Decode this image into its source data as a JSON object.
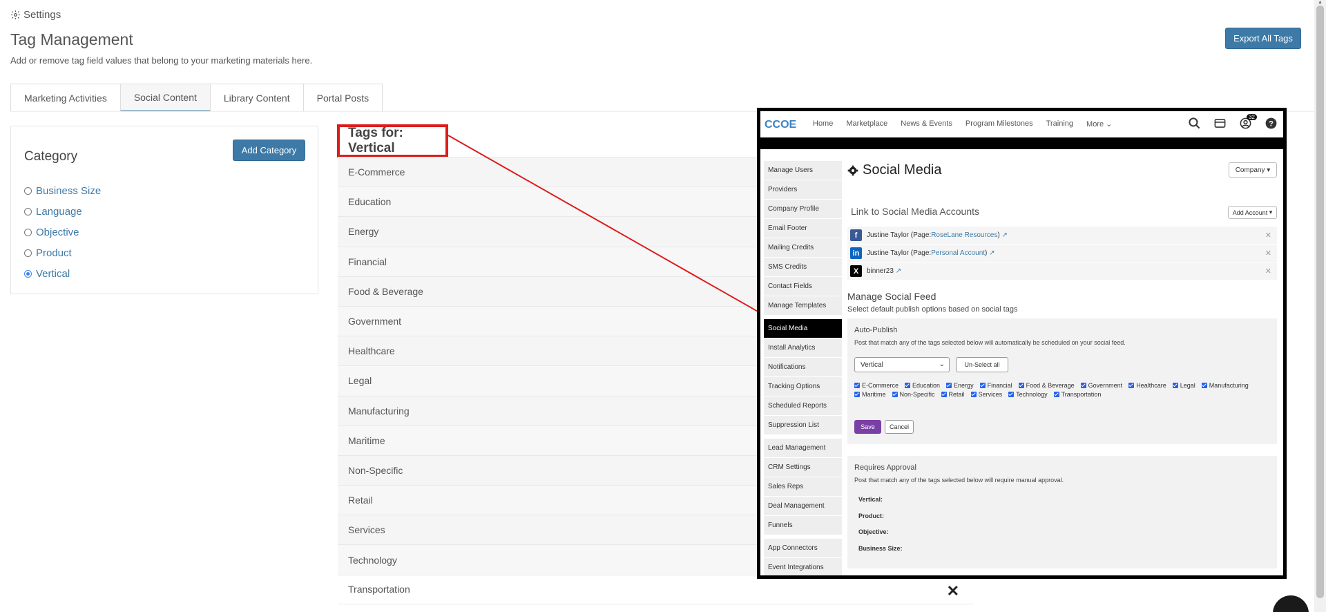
{
  "header": {
    "breadcrumb": "Settings",
    "title": "Tag Management",
    "subtitle": "Add or remove tag field values that belong to your marketing materials here.",
    "export_label": "Export All Tags"
  },
  "tabs": [
    {
      "label": "Marketing Activities",
      "active": false
    },
    {
      "label": "Social Content",
      "active": true
    },
    {
      "label": "Library Content",
      "active": false
    },
    {
      "label": "Portal Posts",
      "active": false
    }
  ],
  "category": {
    "title": "Category",
    "add_label": "Add Category",
    "items": [
      {
        "label": "Business Size",
        "selected": false
      },
      {
        "label": "Language",
        "selected": false
      },
      {
        "label": "Objective",
        "selected": false
      },
      {
        "label": "Product",
        "selected": false
      },
      {
        "label": "Vertical",
        "selected": true
      }
    ]
  },
  "tags": {
    "header": "Tags for: Vertical",
    "items": [
      "E-Commerce",
      "Education",
      "Energy",
      "Financial",
      "Food & Beverage",
      "Government",
      "Healthcare",
      "Legal",
      "Manufacturing",
      "Maritime",
      "Non-Specific",
      "Retail",
      "Services",
      "Technology",
      "Transportation"
    ],
    "delete_icon": "close-icon"
  },
  "inset": {
    "logo": "CCOE",
    "nav": [
      "Home",
      "Marketplace",
      "News & Events",
      "Program Milestones",
      "Training",
      "More"
    ],
    "notification_count": "32",
    "sidebar": [
      [
        "Manage Users",
        "Providers",
        "Company Profile",
        "Email Footer",
        "Mailing Credits",
        "SMS Credits",
        "Contact Fields",
        "Manage Templates"
      ],
      [
        "Social Media",
        "Install Analytics",
        "Notifications",
        "Tracking Options",
        "Scheduled Reports",
        "Suppression List"
      ],
      [
        "Lead Management",
        "CRM Settings",
        "Sales Reps",
        "Deal Management",
        "Funnels"
      ],
      [
        "App Connectors",
        "Event Integrations"
      ]
    ],
    "active_sidebar": "Social Media",
    "page_title": "Social Media",
    "company_label": "Company",
    "link_title": "Link to Social Media Accounts",
    "add_account_label": "Add Account",
    "accounts": [
      {
        "network": "facebook",
        "name": "Justine Taylor (Page: ",
        "link": "RoseLane Resources",
        "suffix": ")"
      },
      {
        "network": "linkedin",
        "name": "Justine Taylor (Page: ",
        "link": "Personal Account",
        "suffix": ")"
      },
      {
        "network": "x",
        "name": "",
        "link": "binner23",
        "suffix": ""
      }
    ],
    "manage_feed_title": "Manage Social Feed",
    "manage_feed_sub": "Select default publish options based on social tags",
    "auto_publish": {
      "title": "Auto-Publish",
      "subtitle": "Post that match any of the tags selected below will automatically be scheduled on your social feed.",
      "select_value": "Vertical",
      "unselect_label": "Un-Select all",
      "checks": [
        "E-Commerce",
        "Education",
        "Energy",
        "Financial",
        "Food & Beverage",
        "Government",
        "Healthcare",
        "Legal",
        "Manufacturing",
        "Maritime",
        "Non-Specific",
        "Retail",
        "Services",
        "Technology",
        "Transportation"
      ],
      "save_label": "Save",
      "cancel_label": "Cancel"
    },
    "requires_approval": {
      "title": "Requires Approval",
      "subtitle": "Post that match any of the tags selected below will require manual approval.",
      "fields": [
        "Vertical:",
        "Product:",
        "Objective:",
        "Business Size:"
      ]
    }
  },
  "colors": {
    "accent": "#3d7aa7",
    "highlight": "#dd1c1c",
    "save": "#7a3fa5"
  }
}
